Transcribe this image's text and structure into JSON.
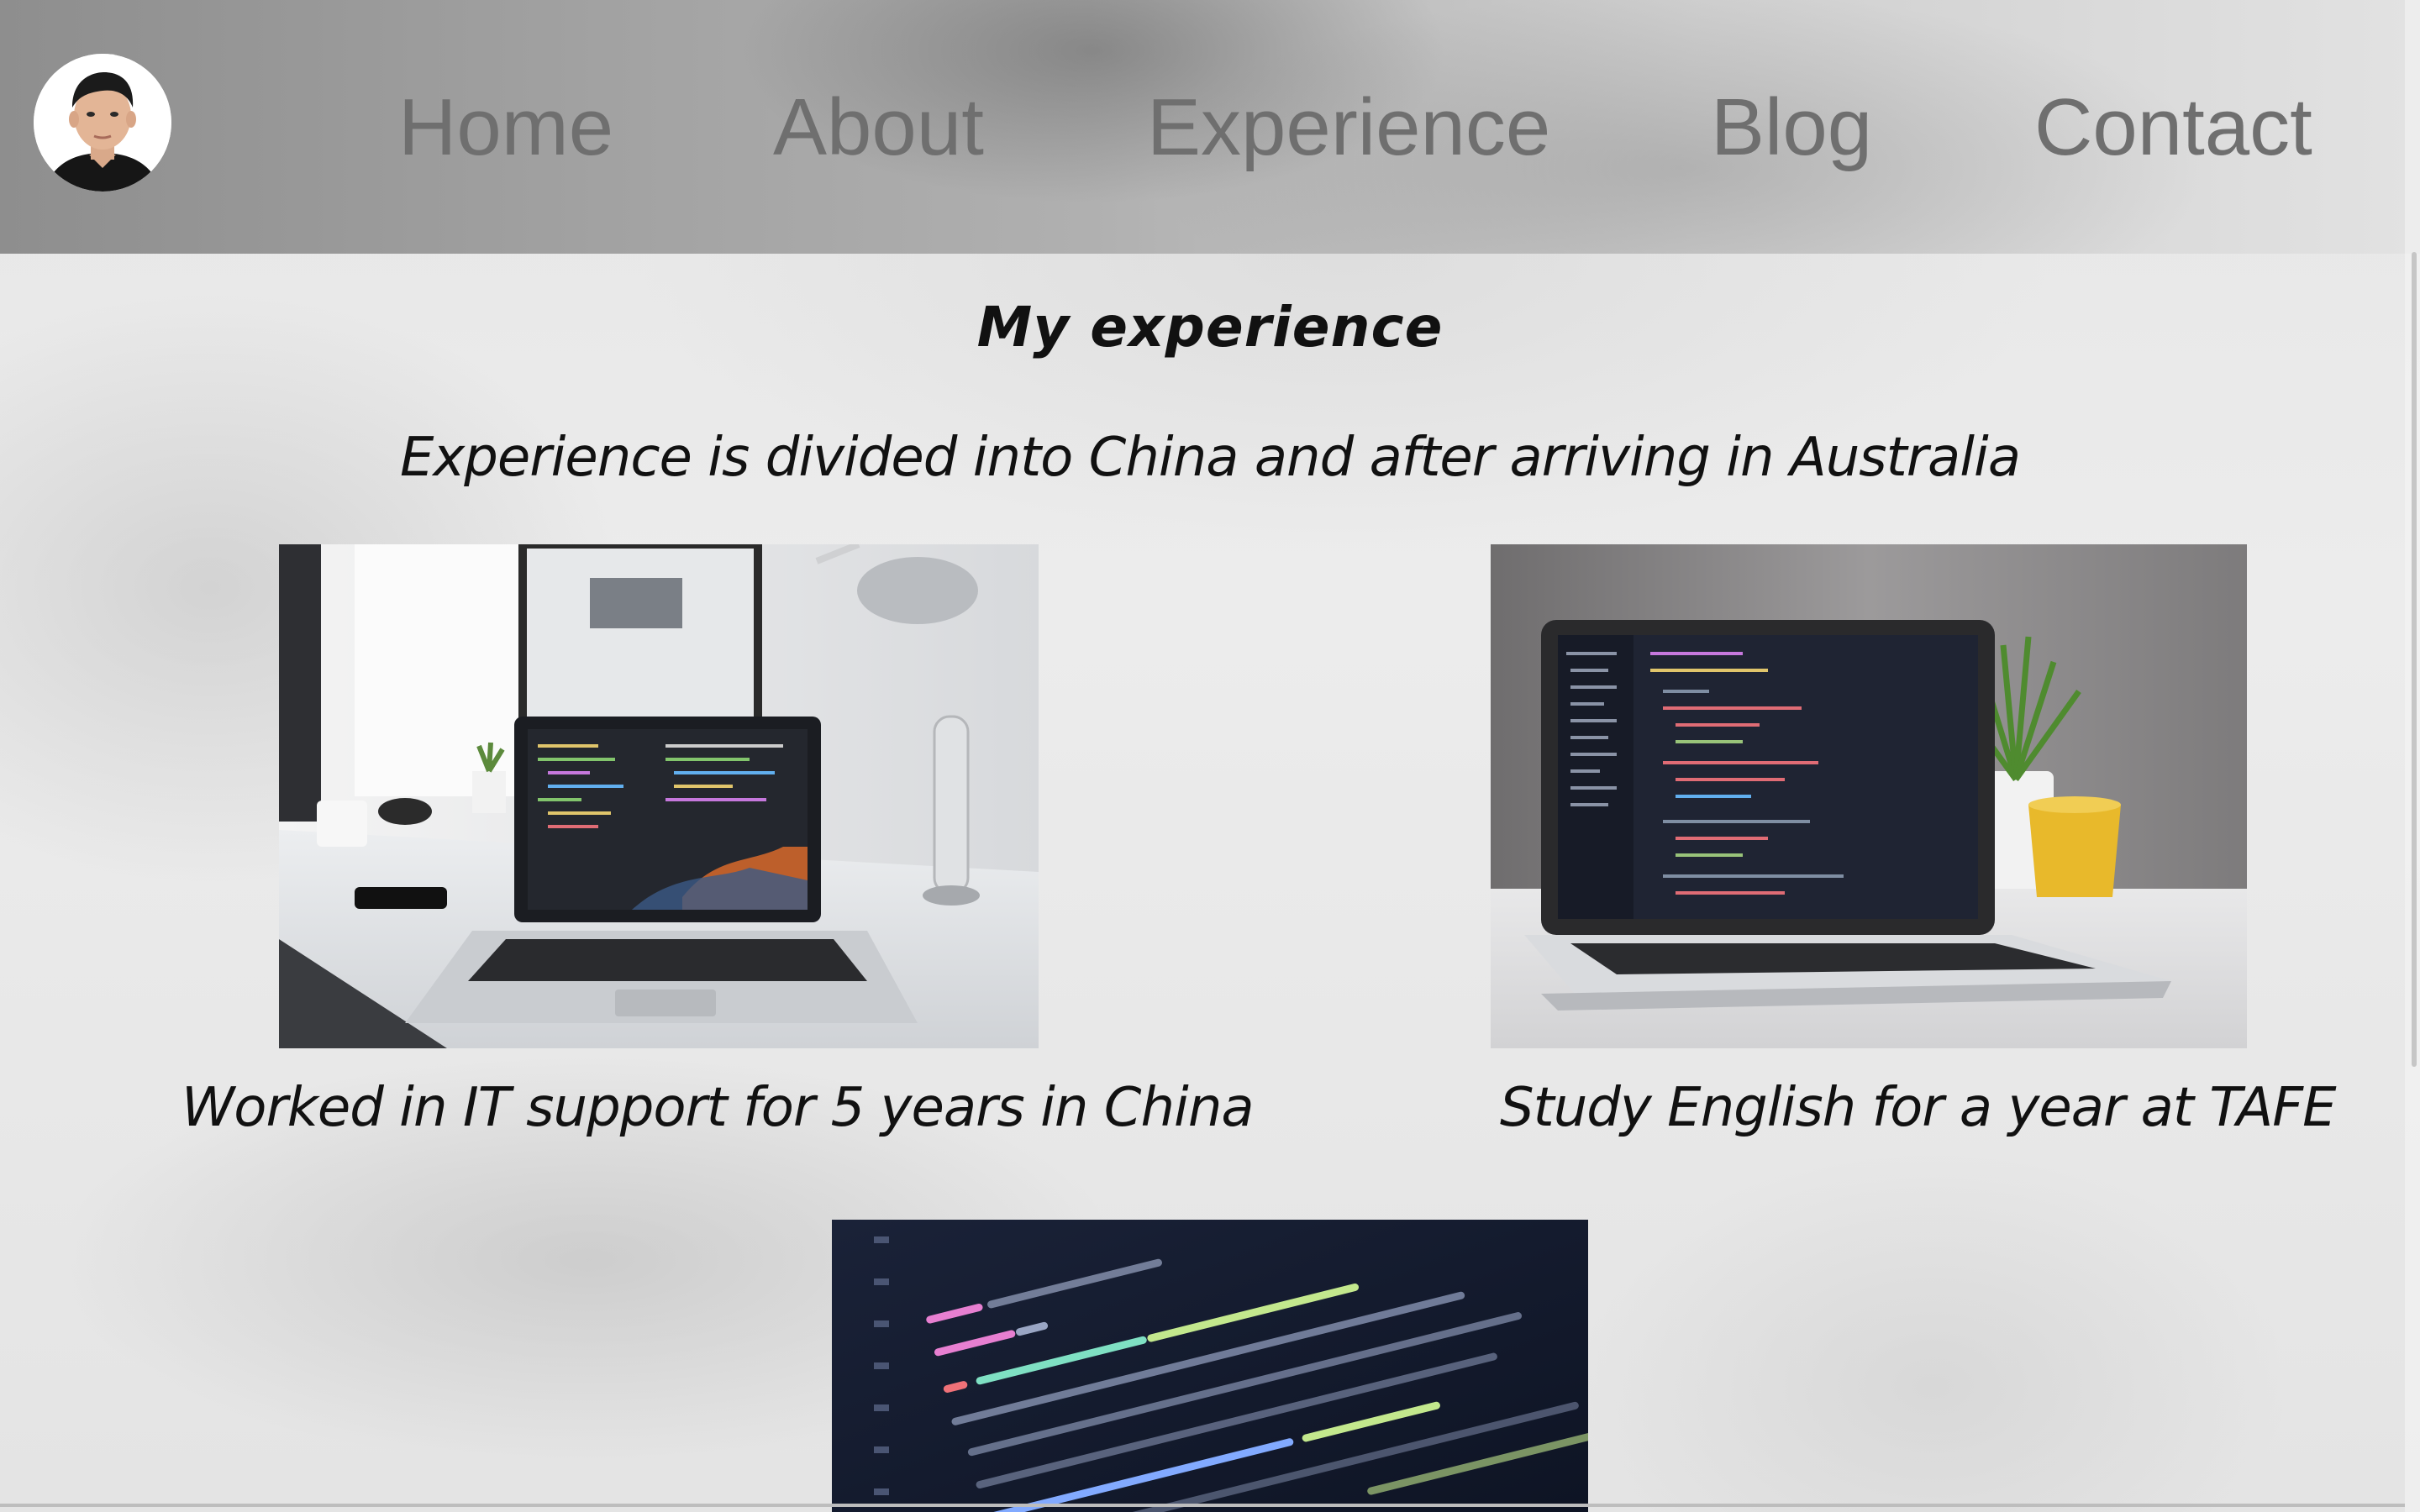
{
  "nav": {
    "items": [
      {
        "label": "Home"
      },
      {
        "label": "About"
      },
      {
        "label": "Experience"
      },
      {
        "label": "Blog"
      },
      {
        "label": "Contact"
      }
    ],
    "color": "#6f6f6f"
  },
  "avatar": {
    "icon": "profile-photo-icon"
  },
  "main": {
    "heading": "My experience",
    "subtitle": "Experience is divided into China and after arriving in Australia",
    "cards": [
      {
        "image_icon": "laptop-on-desk-photo",
        "caption": "Worked in IT support for 5 years in China"
      },
      {
        "image_icon": "laptop-with-code-photo",
        "caption": "Study English for a year at TAFE"
      },
      {
        "image_icon": "code-screen-photo",
        "caption": ""
      }
    ]
  }
}
